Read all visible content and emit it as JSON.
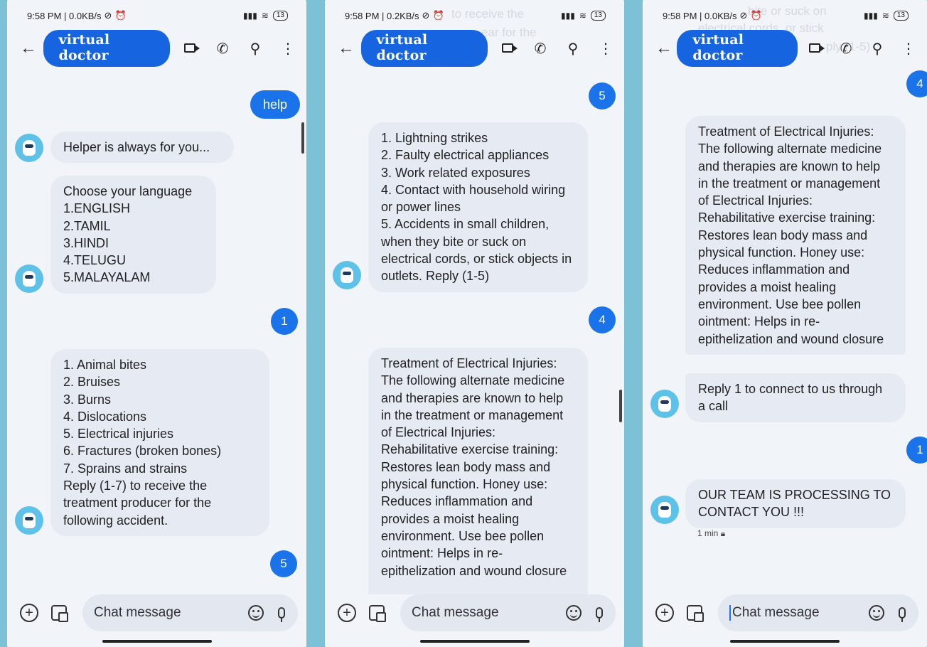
{
  "common": {
    "contact_name": "virtual doctor",
    "input_placeholder": "Chat message"
  },
  "phone1": {
    "status": {
      "time_speed": "9:58 PM | 0.0KB/s",
      "battery": "13"
    },
    "messages": {
      "out_help": "help",
      "in_helper": "Helper is always for you...",
      "in_language": "Choose your language\n1.ENGLISH\n2.TAMIL\n3.HINDI\n4.TELUGU\n5.MALAYALAM",
      "out_1": "1",
      "in_accidents": "1. Animal bites\n2. Bruises\n3. Burns\n4. Dislocations\n5. Electrical injuries\n6. Fractures (broken bones)\n7. Sprains and strains\nReply (1-7) to receive the treatment producer for the following accident.",
      "out_5": "5"
    }
  },
  "phone2": {
    "status": {
      "time_speed": "9:58 PM | 0.2KB/s",
      "battery": "13"
    },
    "ghost": {
      "line1": "to receive the",
      "line2": "ear for the"
    },
    "messages": {
      "out_5": "5",
      "in_causes": "1. Lightning strikes\n2. Faulty electrical appliances\n3. Work related exposures\n4. Contact with household wiring or power lines\n5. Accidents in small children, when they bite or suck on electrical cords, or stick objects in outlets. Reply (1-5)",
      "out_4": "4",
      "in_treatment": "Treatment of Electrical Injuries: The following alternate medicine and therapies are known to help in the treatment or management of Electrical Injuries: Rehabilitative exercise training: Restores lean body mass and physical function. Honey use: Reduces inflammation and provides a moist healing environment. Use bee pollen ointment: Helps in re-epithelization and wound closure"
    }
  },
  "phone3": {
    "status": {
      "time_speed": "9:58 PM | 0.0KB/s",
      "battery": "13"
    },
    "ghost": {
      "line1": "bite or suck on",
      "line2": "electrical cords, or stick",
      "line3": "ply (1-5)"
    },
    "messages": {
      "out_4": "4",
      "in_treatment": "Treatment of Electrical Injuries: The following alternate medicine and therapies are known to help in the treatment or management of Electrical Injuries: Rehabilitative exercise training: Restores lean body mass and physical function. Honey use: Reduces inflammation and provides a moist healing environment. Use bee pollen ointment: Helps in re-epithelization and wound closure",
      "in_reply1": "Reply 1 to connect to us through a call",
      "out_1": "1",
      "in_team": "OUR TEAM IS PROCESSING TO CONTACT YOU !!!",
      "time": "1 min"
    }
  },
  "icons": [
    "back-arrow-icon",
    "video-call-icon",
    "phone-call-icon",
    "search-icon",
    "more-options-icon",
    "add-icon",
    "gallery-icon",
    "emoji-icon",
    "mic-icon",
    "bot-avatar-icon",
    "lock-icon"
  ],
  "colors": {
    "accent": "#1a73e8",
    "background": "#7cc1d6",
    "bubble_in": "#e6ebf3",
    "avatar": "#5ec2e8"
  }
}
